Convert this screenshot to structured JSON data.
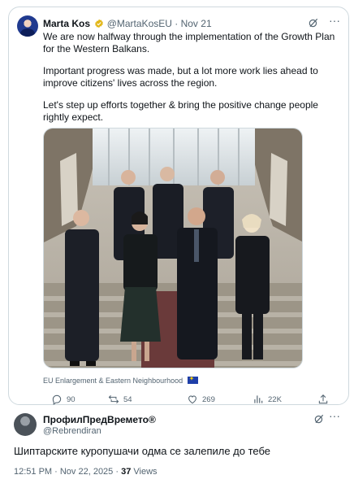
{
  "quoted_tweet": {
    "author_name": "Marta Kos",
    "handle": "@MartaKosEU",
    "separator": "·",
    "date": "Nov 21",
    "paragraphs": [
      "We are now halfway through the implementation of the Growth Plan for the Western Balkans.",
      "Important progress was made, but a lot more work lies ahead to improve citizens' lives across the region.",
      "Let's step up efforts together & bring the positive change people rightly expect."
    ],
    "media_tag": "EU Enlargement & Eastern Neighbourhood",
    "stats": {
      "replies": "90",
      "reposts": "54",
      "likes": "269",
      "views": "22K"
    }
  },
  "reply": {
    "author_name": "ПрофилПредВремето®",
    "handle": "@Rebrendiran",
    "text": "Шиптарските куропушачи одма се залепиле до тебе",
    "timestamp": "12:51 PM · Nov 22, 2025 · ",
    "views_count": "37",
    "views_label": " Views"
  },
  "colors": {
    "text_primary": "#0f1419",
    "text_secondary": "#536471",
    "border": "#cfd9de",
    "verified_gold": "#e2b719"
  },
  "icons": [
    "verified-badge-icon",
    "grok-icon",
    "more-icon",
    "reply-icon",
    "repost-icon",
    "like-icon",
    "views-icon",
    "bookmark-icon",
    "eu-flag-icon"
  ]
}
